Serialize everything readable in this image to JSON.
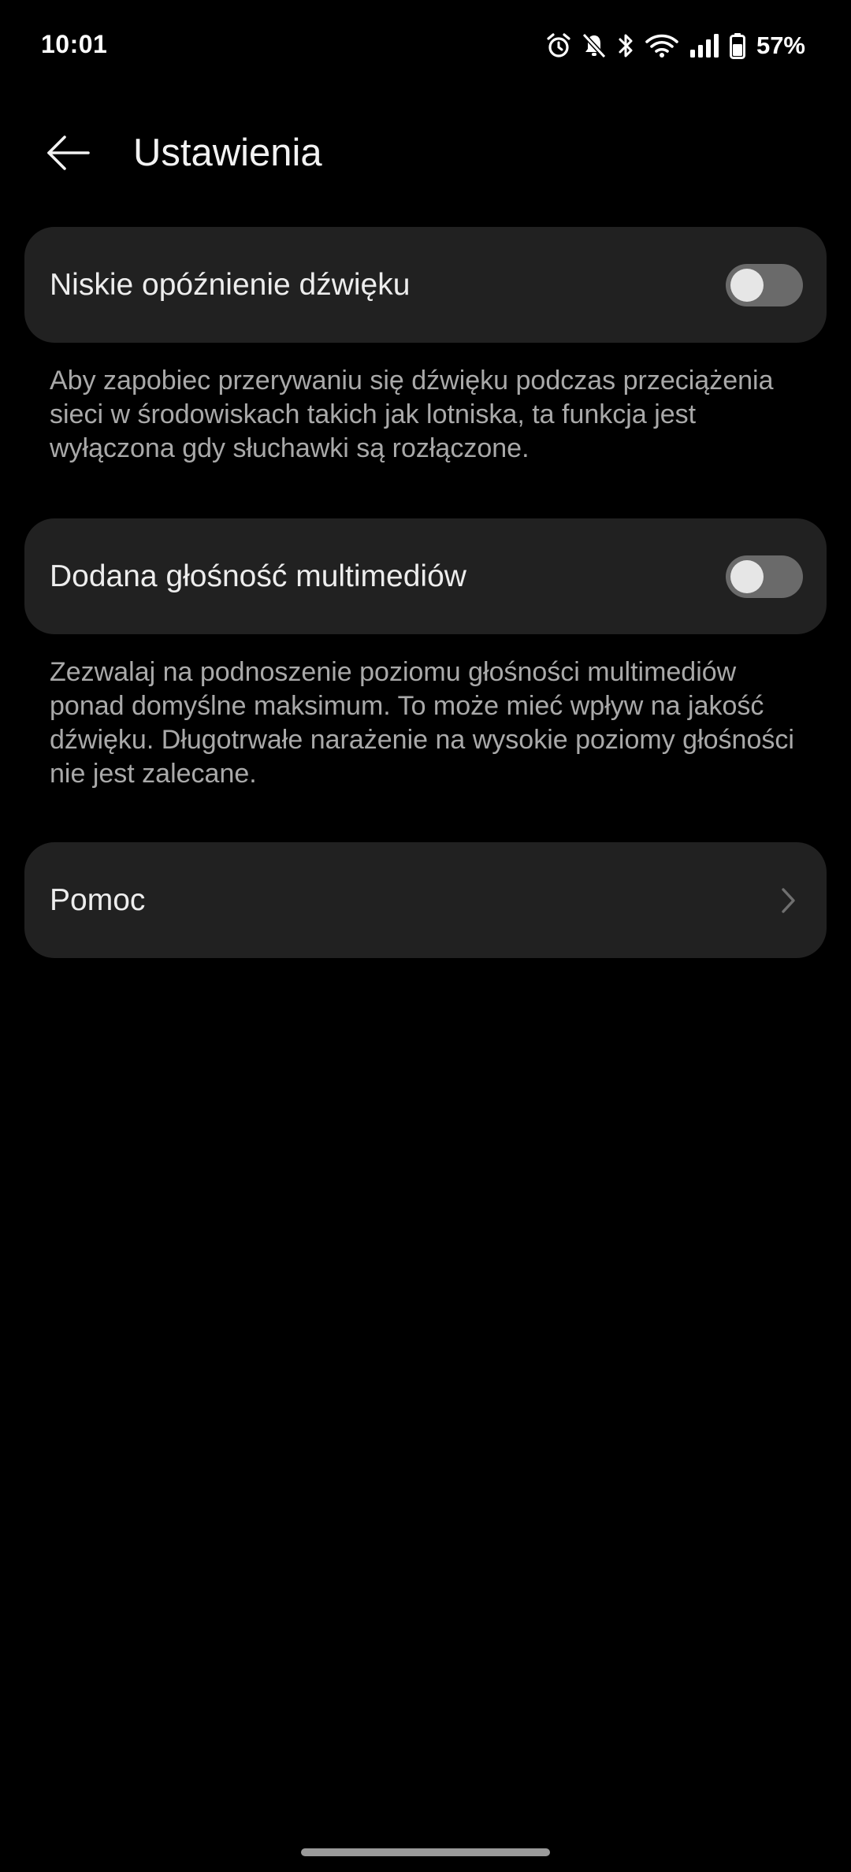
{
  "status_bar": {
    "time": "10:01",
    "battery": "57%",
    "icons": [
      "alarm-icon",
      "bell-off-icon",
      "bluetooth-icon",
      "wifi-icon",
      "signal-icon",
      "battery-icon"
    ]
  },
  "header": {
    "back_icon": "arrow-left-icon",
    "title": "Ustawienia"
  },
  "settings": {
    "low_latency": {
      "label": "Niskie opóźnienie dźwięku",
      "enabled": false,
      "description": "Aby zapobiec przerywaniu się dźwięku podczas przeciążenia sieci w środowiskach takich jak lotniska, ta funkcja jest wyłączona gdy słuchawki są rozłączone."
    },
    "media_volume_boost": {
      "label": "Dodana głośność multimediów",
      "enabled": false,
      "description": "Zezwalaj na podnoszenie poziomu głośności multimediów ponad domyślne maksimum. To może mieć wpływ na jakość dźwięku. Długotrwałe narażenie na wysokie poziomy głośności nie jest zalecane."
    },
    "help": {
      "label": "Pomoc",
      "icon": "chevron-right-icon"
    }
  },
  "colors": {
    "background": "#000000",
    "card": "#212121",
    "toggle_off_track": "#6a6a6a",
    "description_text": "#a9a9a9"
  }
}
